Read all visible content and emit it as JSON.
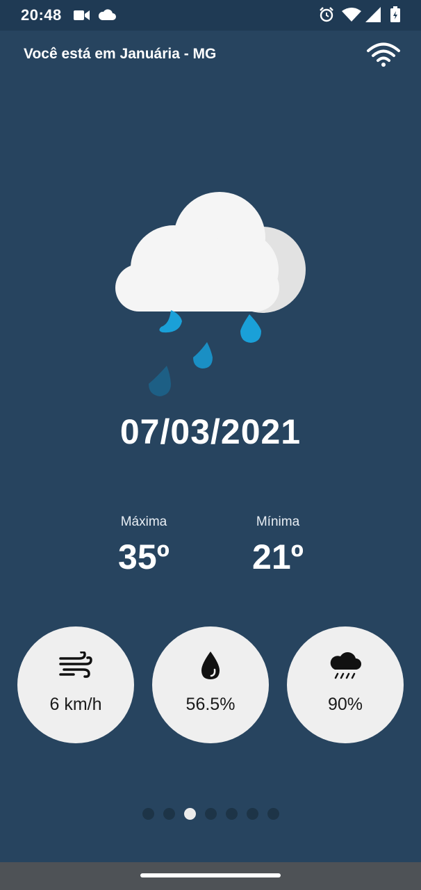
{
  "status_bar": {
    "time": "20:48",
    "left_icons": [
      "video-camera-icon",
      "cloud-icon"
    ],
    "right_icons": [
      "alarm-icon",
      "wifi-signal-icon",
      "cell-signal-icon",
      "battery-icon"
    ]
  },
  "header": {
    "location_title": "Você está em Januária - MG",
    "connection_icon": "wifi-icon"
  },
  "weather": {
    "condition_icon": "rain-cloud-icon",
    "date": "07/03/2021",
    "max_label": "Máxima",
    "max_value": "35º",
    "min_label": "Mínima",
    "min_value": "21º"
  },
  "metrics": [
    {
      "icon": "wind-icon",
      "value": "6 km/h"
    },
    {
      "icon": "humidity-drop-icon",
      "value": "56.5%"
    },
    {
      "icon": "rain-cloud-small-icon",
      "value": "90%"
    }
  ],
  "pager": {
    "total": 7,
    "active_index": 2
  },
  "colors": {
    "background": "#27445f",
    "status_bar": "#1f3a54",
    "card_background": "#efefef",
    "raindrop": "#1aa0d8",
    "nav_bar": "#4e5256"
  }
}
